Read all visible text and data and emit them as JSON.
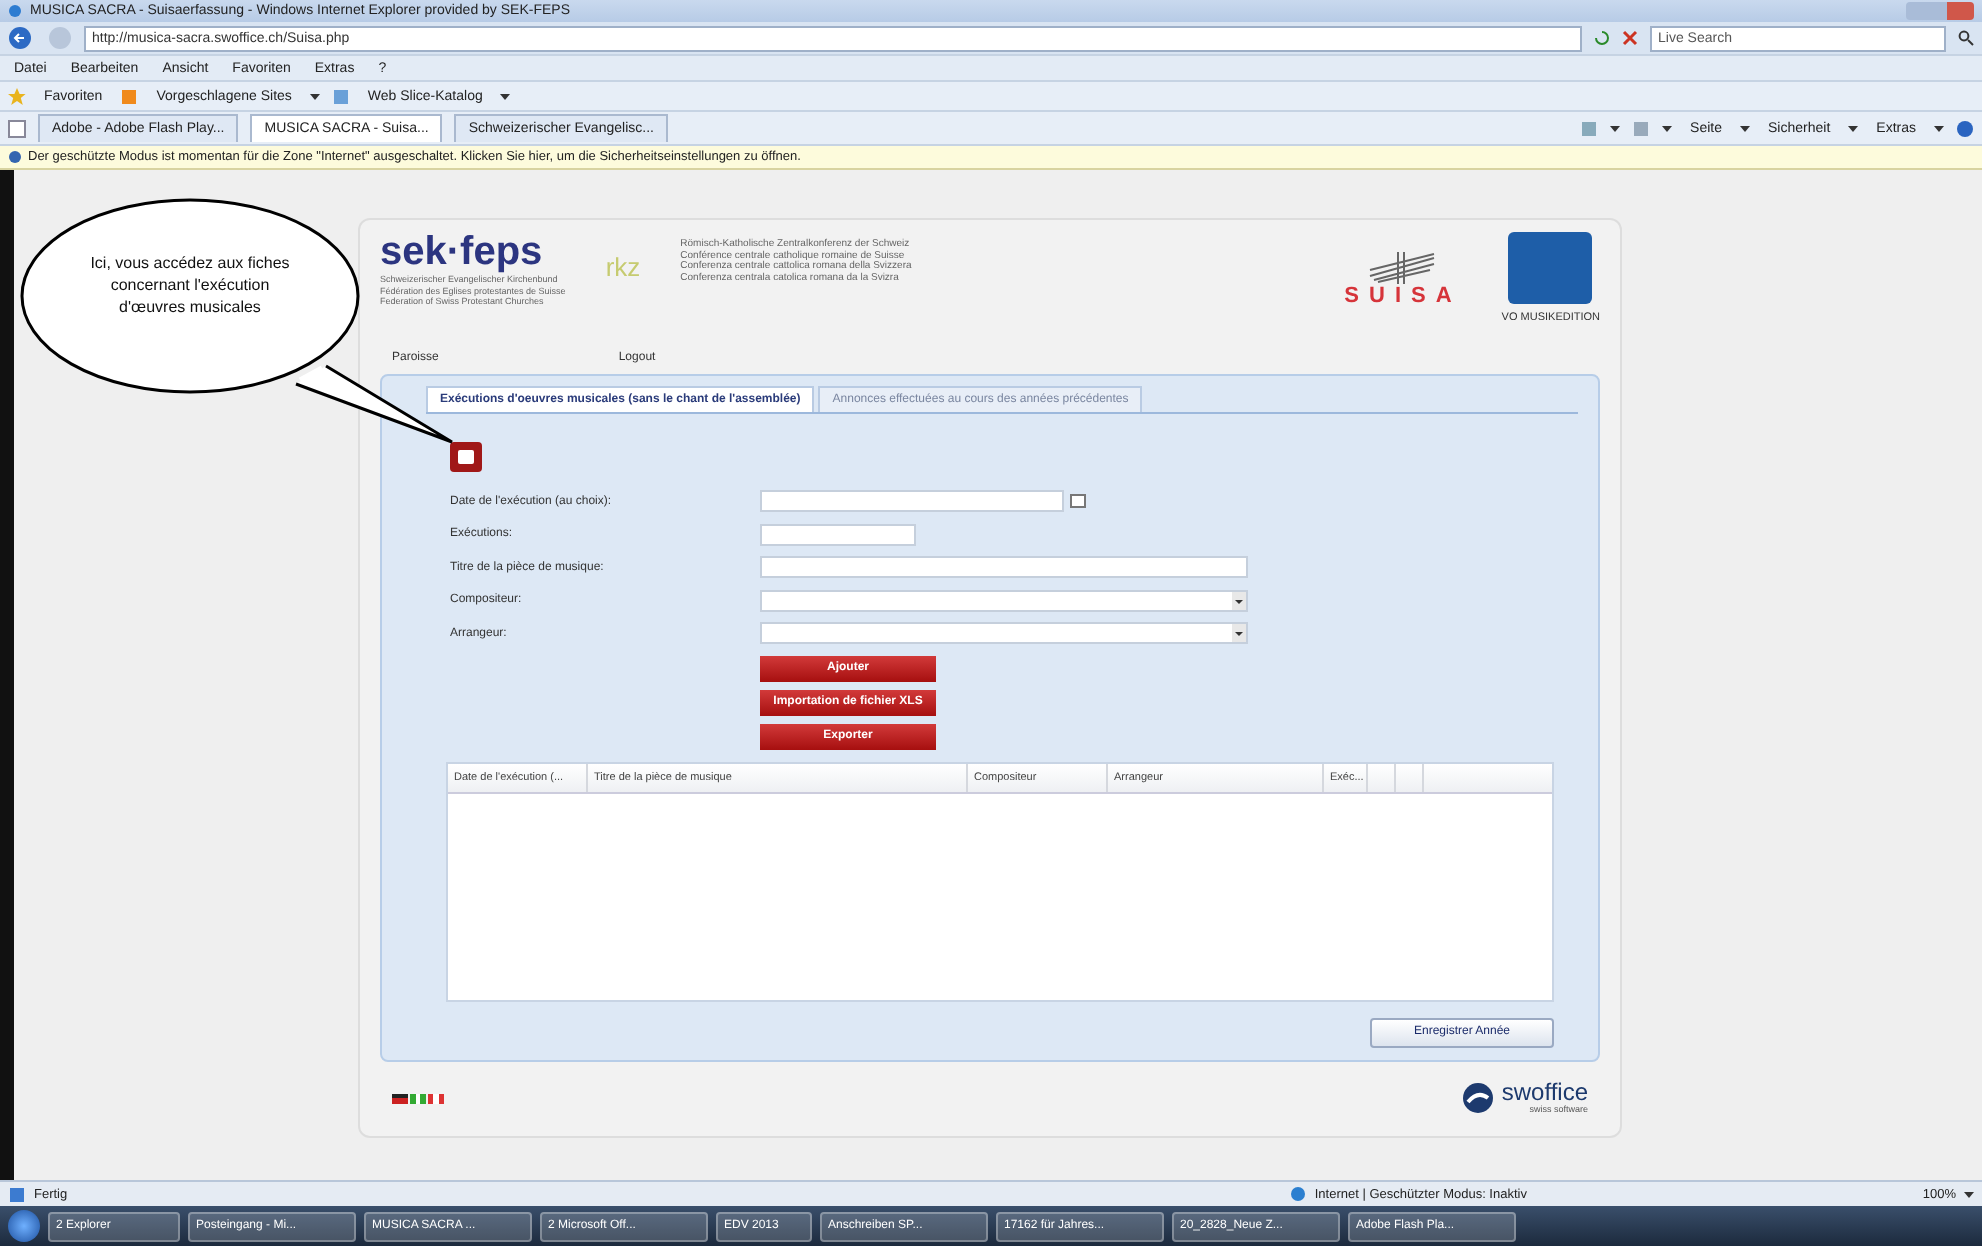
{
  "window": {
    "title": "MUSICA SACRA - Suisaerfassung - Windows Internet Explorer provided by SEK-FEPS"
  },
  "address_bar": {
    "url": "http://musica-sacra.swoffice.ch/Suisa.php",
    "search_placeholder": "Live Search"
  },
  "menu": [
    "Datei",
    "Bearbeiten",
    "Ansicht",
    "Favoriten",
    "Extras",
    "?"
  ],
  "favorites_bar": {
    "label": "Favoriten",
    "items": [
      "Vorgeschlagene Sites",
      "Web Slice-Katalog"
    ]
  },
  "browser_tabs": [
    {
      "label": "Adobe - Adobe Flash Play...",
      "selected": false
    },
    {
      "label": "MUSICA SACRA - Suisa...",
      "selected": true
    },
    {
      "label": "Schweizerischer Evangelisc...",
      "selected": false
    }
  ],
  "command_bar": [
    "Seite",
    "Sicherheit",
    "Extras"
  ],
  "info_bar": "Der geschützte Modus ist momentan für die Zone \"Internet\" ausgeschaltet. Klicken Sie hier, um die Sicherheitseinstellungen zu öffnen.",
  "page": {
    "sek_logo": "sek·feps",
    "sek_lines": [
      "Schweizerischer Evangelischer Kirchenbund",
      "Fédération des Eglises protestantes de Suisse",
      "Federation of Swiss Protestant Churches"
    ],
    "rkz_logo": "rkz",
    "rkz_lines": [
      "Römisch-Katholische Zentralkonferenz der Schweiz",
      "Conférence centrale catholique romaine de Suisse",
      "Conferenza centrale cattolica romana della Svizzera",
      "Conferenza centrala catolica romana da la Svizra"
    ],
    "suisa_logo": "SUISA",
    "vo_logo": "VO MUSIKEDITION",
    "nav": [
      "Paroisse",
      "Logout"
    ],
    "tabs": [
      {
        "label": "Exécutions d'oeuvres musicales (sans le chant de l'assemblée)",
        "selected": true
      },
      {
        "label": "Annonces effectuées au cours des années précédentes",
        "selected": false
      }
    ],
    "fields": [
      {
        "label": "Date de l'exécution (au choix):",
        "kind": "date"
      },
      {
        "label": "Exécutions:",
        "kind": "short"
      },
      {
        "label": "Titre de la pièce de musique:",
        "kind": "text"
      },
      {
        "label": "Compositeur:",
        "kind": "select"
      },
      {
        "label": "Arrangeur:",
        "kind": "select"
      }
    ],
    "buttons": [
      "Ajouter",
      "Importation de fichier XLS",
      "Exporter"
    ],
    "table": {
      "columns": [
        "Date de l'exécution (...",
        "Titre de la pièce de musique",
        "Compositeur",
        "Arrangeur",
        "Exéc..."
      ]
    },
    "save_button": "Enregistrer Année",
    "footer": {
      "brand": "swoffice",
      "tagline": "swiss software"
    }
  },
  "status_bar": {
    "text": "Fertig",
    "zone": "Internet | Geschützter Modus: Inaktiv",
    "zoom": "100%"
  },
  "taskbar": [
    "2 Explorer",
    "Posteingang - Mi...",
    "MUSICA SACRA ...",
    "2 Microsoft Off...",
    "EDV 2013",
    "Anschreiben SP...",
    "17162 für Jahres...",
    "20_2828_Neue Z...",
    "Adobe Flash Pla..."
  ],
  "callout": {
    "text": "Ici, vous accédez aux fiches concernant l'exécution d'œuvres musicales"
  }
}
